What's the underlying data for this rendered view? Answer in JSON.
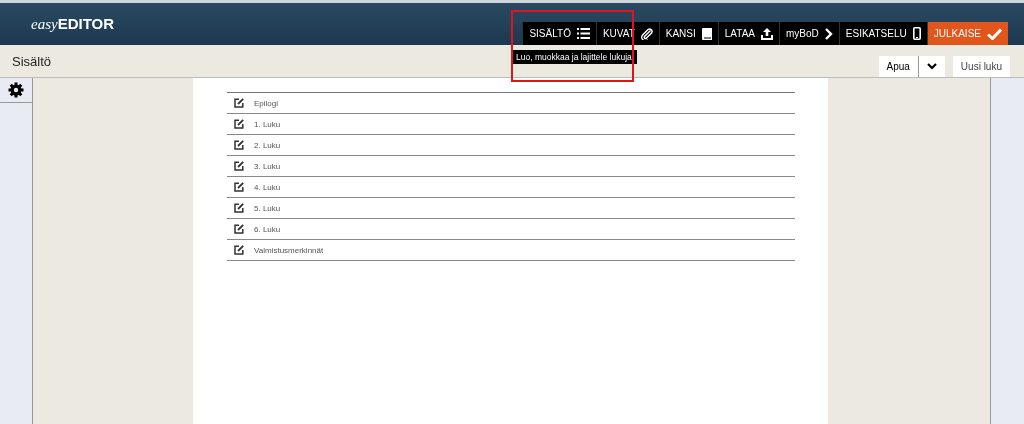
{
  "logo": {
    "prefix": "easy",
    "name": "EDITOR"
  },
  "nav": [
    {
      "label": "SISÄLTÖ",
      "kind": "tab"
    },
    {
      "label": "KUVAT",
      "kind": "tab"
    },
    {
      "label": "KANSI",
      "kind": "tab"
    },
    {
      "label": "LATAA",
      "kind": "tab"
    },
    {
      "label": "myBoD",
      "kind": "tab"
    },
    {
      "label": "ESIKATSELU",
      "kind": "tab"
    },
    {
      "label": "JULKAISE",
      "kind": "publish"
    }
  ],
  "tooltip": "Luo, muokkaa ja lajittele lukuja.",
  "page_title": "Sisältö",
  "help_button": "Apua",
  "new_chapter_button": "Uusi luku",
  "chapters": [
    {
      "title": "Epilogi"
    },
    {
      "title": "1. Luku"
    },
    {
      "title": "2. Luku"
    },
    {
      "title": "3. Luku"
    },
    {
      "title": "4. Luku"
    },
    {
      "title": "5. Luku"
    },
    {
      "title": "6. Luku"
    },
    {
      "title": "Valmistusmerkinnät"
    }
  ]
}
